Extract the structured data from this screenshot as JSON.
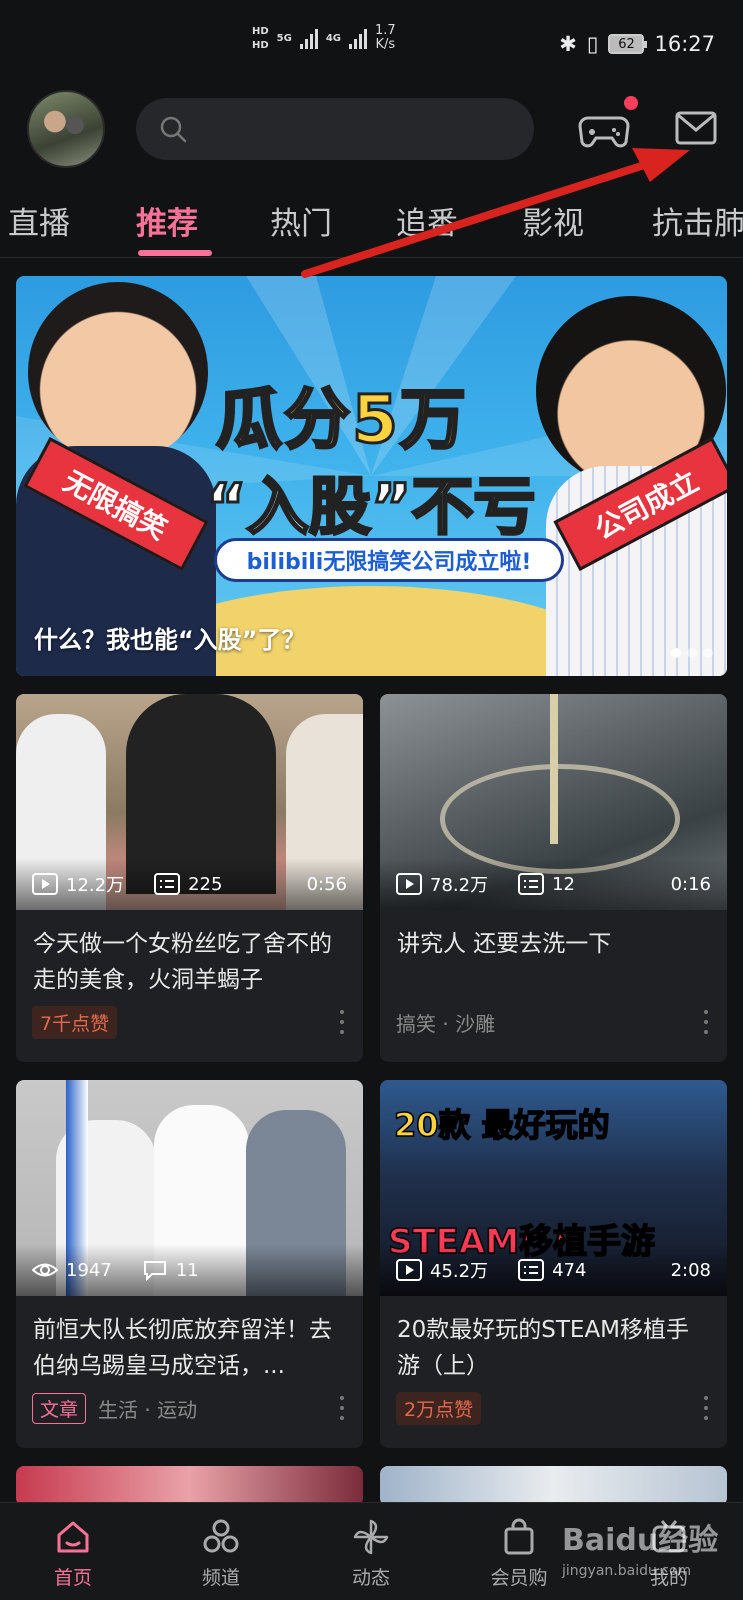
{
  "status_bar": {
    "network_badge_1": "HD",
    "network_badge_2": "HD",
    "net_type_1": "5G",
    "net_type_2": "4G",
    "speed_value": "1.7",
    "speed_unit": "K/s",
    "battery": "62",
    "time": "16:27"
  },
  "header": {
    "search_placeholder": ""
  },
  "tabs": [
    "直播",
    "推荐",
    "热门",
    "追番",
    "影视",
    "抗击肺"
  ],
  "active_tab": "推荐",
  "banner": {
    "title_line1": "瓜分5万",
    "title_line2": "“入股”不亏",
    "strip_text": "bilibili无限搞笑公司成立啦!",
    "left_sash": "无限搞笑",
    "right_sash": "公司成立",
    "caption": "什么？我也能“入股”了？",
    "page_count": 3,
    "current_page": 1
  },
  "feed": [
    {
      "views": "12.2万",
      "comments": "225",
      "duration": "0:56",
      "title": "今天做一个女粉丝吃了舍不的走的美食，火洞羊蝎子",
      "badge": "7千点赞",
      "tag": "",
      "category": ""
    },
    {
      "views": "78.2万",
      "comments": "12",
      "duration": "0:16",
      "title": "讲究人 还要去洗一下",
      "badge": "",
      "tag": "",
      "category": "搞笑 · 沙雕"
    },
    {
      "views": "1947",
      "comments": "11",
      "duration": "",
      "title": "前恒大队长彻底放弃留洋！去伯纳乌踢皇马成空话，...",
      "badge": "",
      "tag": "文章",
      "category": "生活 · 运动"
    },
    {
      "views": "45.2万",
      "comments": "474",
      "duration": "2:08",
      "title": "20款最好玩的STEAM移植手游（上）",
      "badge": "2万点赞",
      "tag": "",
      "category": "",
      "thumb_text_top": "20款 最好玩的",
      "thumb_text_bottom": "STEAM移植手游"
    }
  ],
  "bottom_nav": [
    {
      "label": "首页",
      "icon": "home-icon"
    },
    {
      "label": "频道",
      "icon": "channel-icon"
    },
    {
      "label": "动态",
      "icon": "dynamic-icon"
    },
    {
      "label": "会员购",
      "icon": "shop-icon"
    },
    {
      "label": "我的",
      "icon": "profile-icon"
    }
  ],
  "watermark": {
    "brand": "Baidu经验",
    "url": "jingyan.baidu.com"
  },
  "colors": {
    "accent": "#fb7299",
    "annotation_arrow": "#d9231f",
    "background": "#111214"
  }
}
